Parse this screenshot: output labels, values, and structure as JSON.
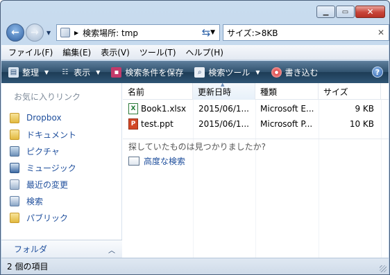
{
  "address": {
    "path": "検索場所: tmp",
    "search_query": "サイズ:>8KB"
  },
  "menu": {
    "items": [
      "ファイル(F)",
      "編集(E)",
      "表示(V)",
      "ツール(T)",
      "ヘルプ(H)"
    ]
  },
  "toolbar": {
    "organize": "整理",
    "view": "表示",
    "save_search": "検索条件を保存",
    "search_tools": "検索ツール",
    "burn": "書き込む"
  },
  "nav": {
    "favorites_header": "お気に入りリンク",
    "items": [
      {
        "label": "Dropbox",
        "icon": "folder-icon"
      },
      {
        "label": "ドキュメント",
        "icon": "documents-icon"
      },
      {
        "label": "ピクチャ",
        "icon": "pictures-icon"
      },
      {
        "label": "ミュージック",
        "icon": "music-icon"
      },
      {
        "label": "最近の変更",
        "icon": "recent-changes-icon"
      },
      {
        "label": "検索",
        "icon": "searches-icon"
      },
      {
        "label": "パブリック",
        "icon": "public-folder-icon"
      }
    ],
    "folders_label": "フォルダ"
  },
  "columns": [
    "名前",
    "更新日時",
    "種類",
    "サイズ"
  ],
  "files": [
    {
      "name": "Book1.xlsx",
      "date": "2015/06/1...",
      "type": "Microsoft E...",
      "size": "9 KB",
      "icon": "excel-file-icon"
    },
    {
      "name": "test.ppt",
      "date": "2015/06/1...",
      "type": "Microsoft P...",
      "size": "10 KB",
      "icon": "powerpoint-file-icon"
    }
  ],
  "not_found_prompt": "探していたものは見つかりましたか?",
  "advanced_search": "高度な検索",
  "status": "2 個の項目"
}
